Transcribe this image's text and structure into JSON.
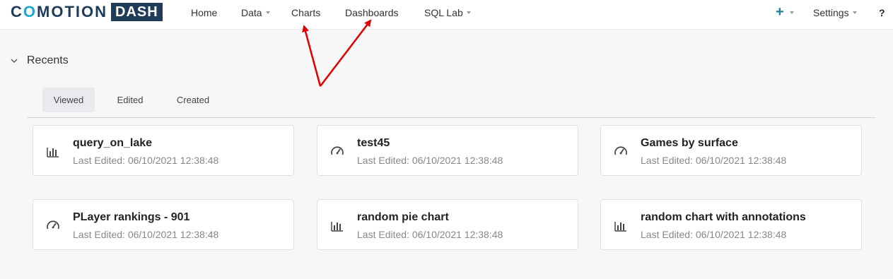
{
  "navbar": {
    "logo_word_pre": "C",
    "logo_word_accent": "O",
    "logo_word_post": "MOTION",
    "logo_box": "DASH",
    "items": [
      {
        "label": "Home",
        "has_caret": false
      },
      {
        "label": "Data",
        "has_caret": true
      },
      {
        "label": "Charts",
        "has_caret": false
      },
      {
        "label": "Dashboards",
        "has_caret": false
      },
      {
        "label": "SQL Lab",
        "has_caret": true
      }
    ],
    "plus_label": "+",
    "settings_label": "Settings",
    "help_label": "?"
  },
  "recents": {
    "title": "Recents",
    "tabs": [
      {
        "label": "Viewed",
        "active": true
      },
      {
        "label": "Edited",
        "active": false
      },
      {
        "label": "Created",
        "active": false
      }
    ],
    "cards": [
      {
        "title": "query_on_lake",
        "subtitle": "Last Edited: 06/10/2021 12:38:48",
        "icon": "bar-chart-icon"
      },
      {
        "title": "test45",
        "subtitle": "Last Edited: 06/10/2021 12:38:48",
        "icon": "gauge-icon"
      },
      {
        "title": "Games by surface",
        "subtitle": "Last Edited: 06/10/2021 12:38:48",
        "icon": "gauge-icon"
      },
      {
        "title": "PLayer rankings - 901",
        "subtitle": "Last Edited: 06/10/2021 12:38:48",
        "icon": "gauge-icon"
      },
      {
        "title": "random pie chart",
        "subtitle": "Last Edited: 06/10/2021 12:38:48",
        "icon": "bar-chart-icon"
      },
      {
        "title": "random chart with annotations",
        "subtitle": "Last Edited: 06/10/2021 12:38:48",
        "icon": "bar-chart-icon"
      }
    ]
  },
  "colors": {
    "brand_navy": "#1f3b5a",
    "brand_cyan": "#20a7c9",
    "annotation_red": "#e00000"
  }
}
